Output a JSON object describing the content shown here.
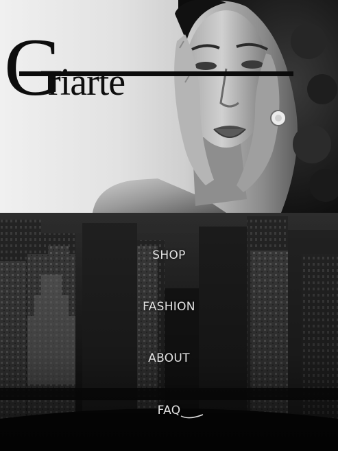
{
  "brand": {
    "logo_text": "Griarte",
    "logo_initial": "G",
    "logo_rest": "riarte"
  },
  "hero": {
    "image": "portrait-model-hands-on-face",
    "tone": "black-and-white"
  },
  "nav": {
    "background_image": "city-skyline-aerial",
    "items": [
      {
        "label": "SHOP"
      },
      {
        "label": "FASHION"
      },
      {
        "label": "ABOUT"
      },
      {
        "label": "FAQ"
      }
    ]
  },
  "colors": {
    "nav_text": "#e4e4e4",
    "logo": "#0d0d0d",
    "nav_background": "#1b1b1b"
  }
}
